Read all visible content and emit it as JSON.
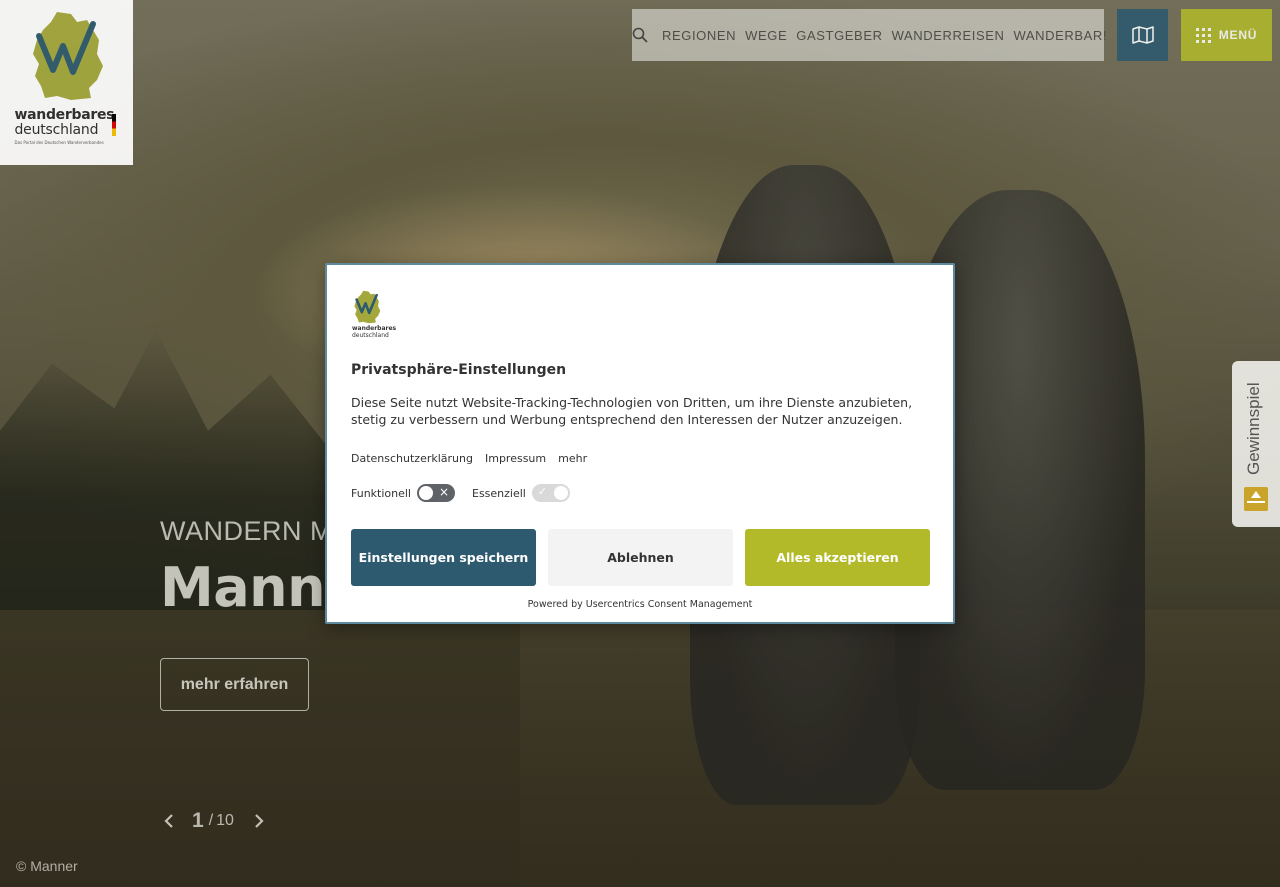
{
  "brand": {
    "wordmark_line1": "wanderbares",
    "wordmark_line2": "deutschland",
    "tagline": "Das Portal des Deutschen Wanderverbandes",
    "accent": "#b2ba2a",
    "primary": "#2d5a6e"
  },
  "header": {
    "search_icon": "search-icon",
    "nav": [
      "REGIONEN",
      "WEGE",
      "GASTGEBER",
      "WANDERREISEN",
      "WANDERBAR!"
    ],
    "map_icon": "map-icon",
    "menu_label": "MENÜ"
  },
  "hero": {
    "eyebrow": "WANDERN MA",
    "headline": "Manne",
    "cta": "mehr erfahren",
    "pager": {
      "current": "1",
      "separator": "/",
      "total": "10"
    },
    "copyright": "© Manner"
  },
  "side_tab": {
    "label": "Gewinnspiel"
  },
  "consent": {
    "title": "Privatsphäre-Einstellungen",
    "description": "Diese Seite nutzt Website-Tracking-Technologien von Dritten, um ihre Dienste anzubieten, stetig zu verbessern und Werbung entsprechend den Interessen der Nutzer anzuzeigen.",
    "links": [
      "Datenschutzerklärung",
      "Impressum",
      "mehr"
    ],
    "toggles": [
      {
        "label": "Funktionell",
        "state": "off"
      },
      {
        "label": "Essenziell",
        "state": "on-disabled"
      }
    ],
    "buttons": {
      "save": "Einstellungen speichern",
      "deny": "Ablehnen",
      "accept": "Alles akzeptieren"
    },
    "powered_by": "Powered by Usercentrics Consent Management"
  }
}
